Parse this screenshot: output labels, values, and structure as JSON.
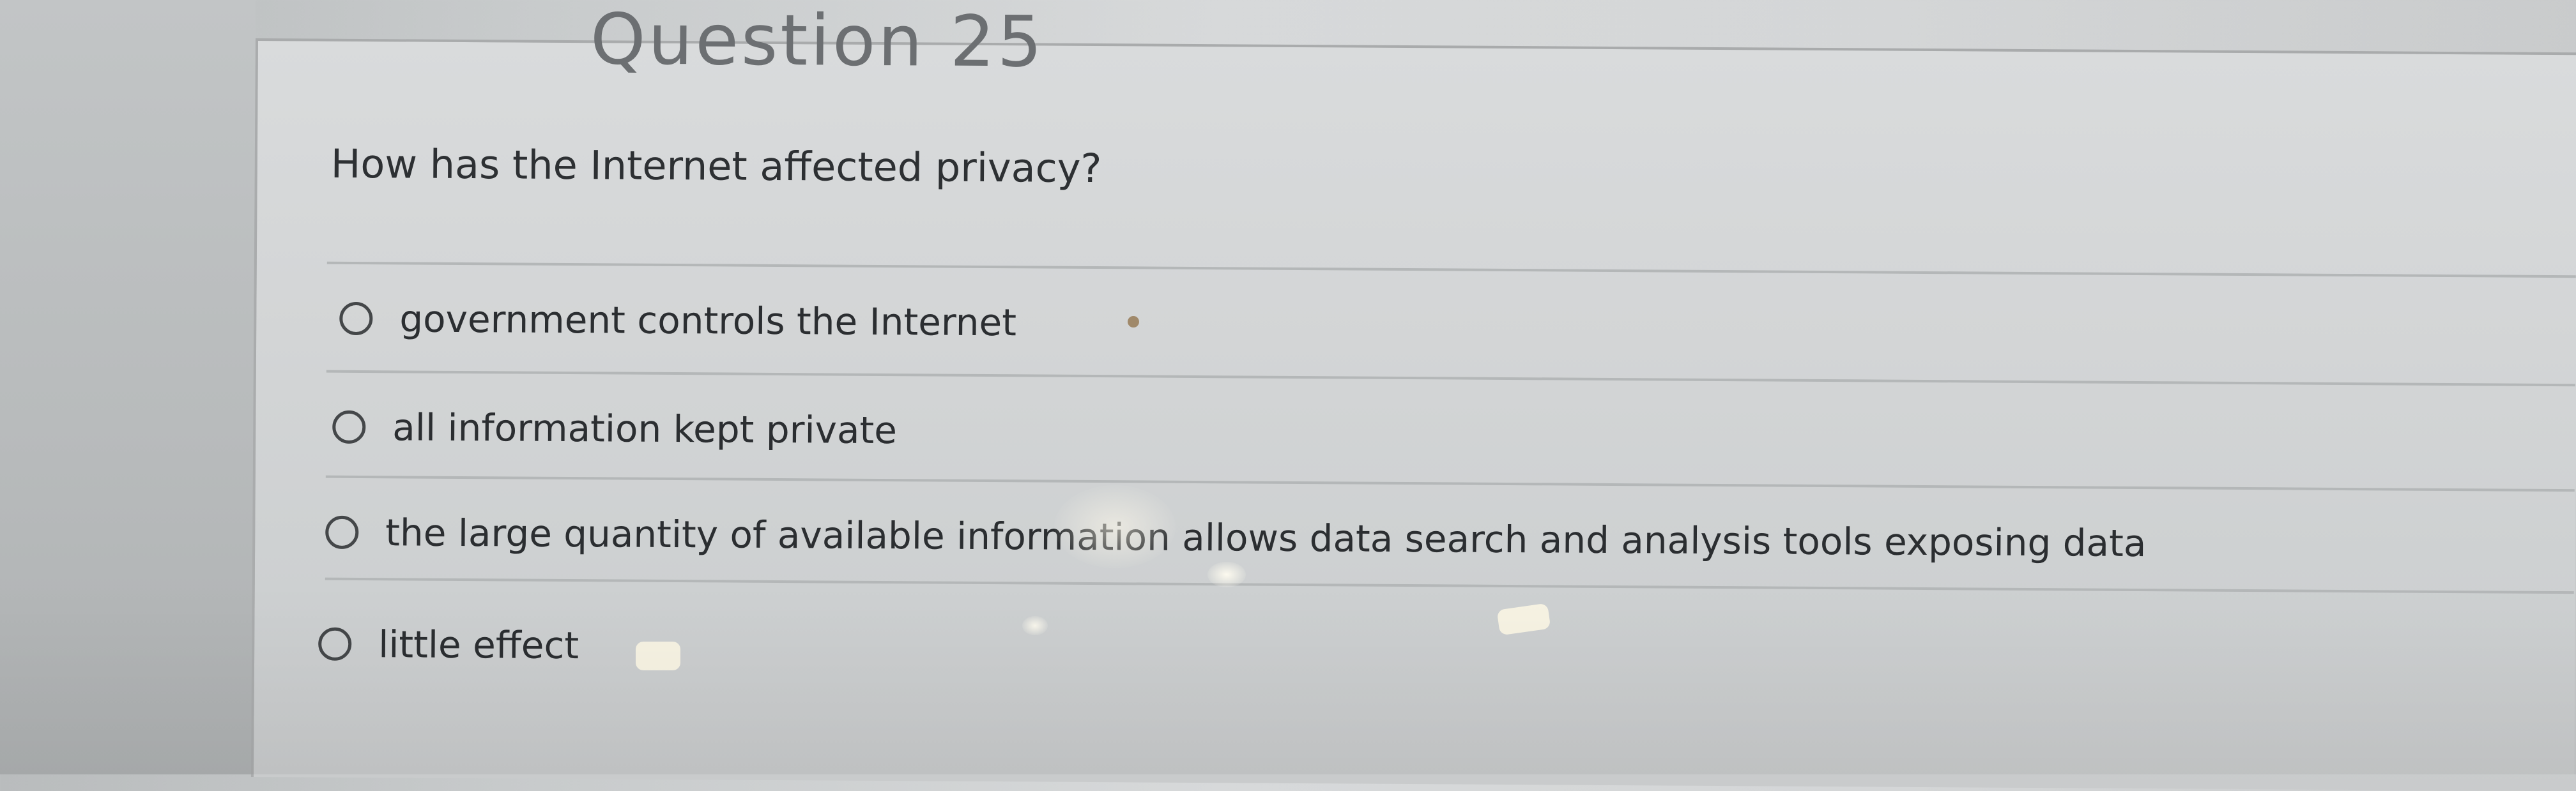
{
  "header": {
    "question_heading_fragment": "Question 25"
  },
  "question": {
    "text": "How has the Internet affected privacy?"
  },
  "options": [
    {
      "label": "government controls the Internet",
      "selected": false
    },
    {
      "label": "all information kept private",
      "selected": false
    },
    {
      "label": "the large quantity of available information allows data search and analysis tools exposing data",
      "selected": false
    },
    {
      "label": "little effect",
      "selected": false
    }
  ],
  "colors": {
    "text": "#2d3033",
    "radio_border": "#444749",
    "page_background": "#d3d5d6"
  }
}
